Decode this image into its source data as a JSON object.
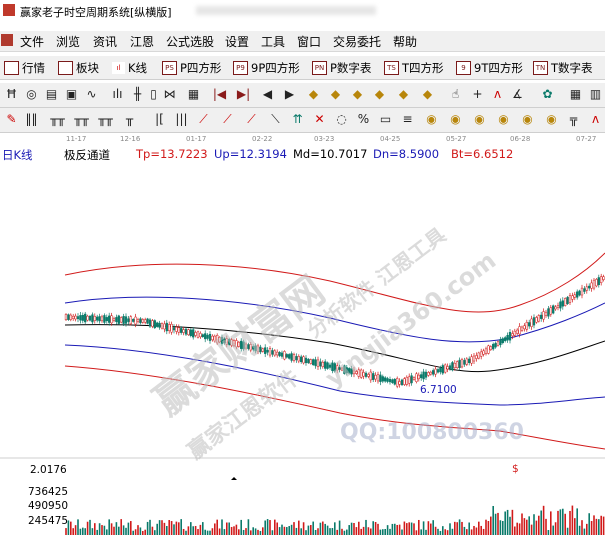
{
  "window": {
    "title": "赢家老子时空周期系统[纵横版]"
  },
  "menu": [
    "文件",
    "浏览",
    "资讯",
    "江恩",
    "公式选股",
    "设置",
    "工具",
    "窗口",
    "交易委托",
    "帮助"
  ],
  "toolbar1": [
    "行情",
    "板块",
    "K线",
    "P四方形",
    "9P四方形",
    "P数字表",
    "T四方形",
    "9T四方形",
    "T数字表"
  ],
  "toolbar1_icons": [
    "TS",
    "9",
    "TN",
    "PS",
    "P9",
    "PN"
  ],
  "dates": [
    "11-17",
    "12-16",
    "01-17",
    "02-22",
    "03-23",
    "04-25",
    "05-27",
    "06-28",
    "07-27"
  ],
  "chart": {
    "period_label": "日K线",
    "indicator_name": "极反通道",
    "tp": "Tp=13.7223",
    "up": "Up=12.3194",
    "md": "Md=10.7017",
    "dn": "Dn=8.5900",
    "bt": "Bt=6.6512",
    "low_marker": "6.7100",
    "volume_top_label": "2.0176",
    "volume_labels": [
      "736425",
      "490950",
      "245475"
    ],
    "dollar_mark": "$"
  },
  "watermarks": [
    "赢家财富网",
    "赢家江恩软件",
    "分析软件 江恩工具",
    "yingjia360.com",
    "QQ:100800360"
  ],
  "colors": {
    "red": "#d11a1a",
    "blue": "#1a1ab5",
    "black": "#000000",
    "teal": "#0a7a6a"
  }
}
